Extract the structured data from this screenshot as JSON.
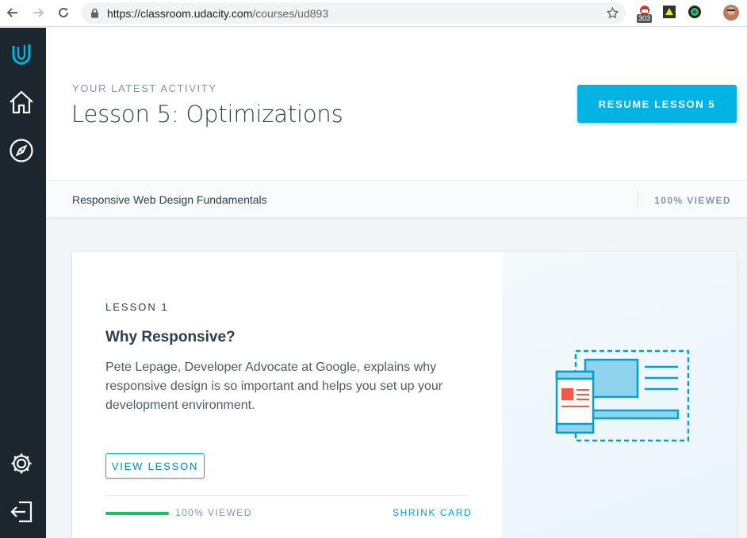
{
  "browser": {
    "url_host": "https://classroom.udacity.com",
    "url_path": "/courses/ud893",
    "extension_badge": "303",
    "icons": [
      "back-arrow-icon",
      "forward-arrow-icon",
      "reload-icon",
      "lock-icon",
      "star-icon"
    ]
  },
  "sidebar": {
    "items": [
      {
        "name": "udacity-logo-icon"
      },
      {
        "name": "home-icon"
      },
      {
        "name": "compass-icon"
      },
      {
        "name": "gear-icon"
      },
      {
        "name": "sign-out-icon"
      }
    ]
  },
  "header": {
    "eyebrow": "YOUR LATEST ACTIVITY",
    "title": "Lesson 5: Optimizations",
    "resume_label": "RESUME LESSON 5"
  },
  "subbar": {
    "course_name": "Responsive Web Design Fundamentals",
    "viewed": "100% VIEWED"
  },
  "card": {
    "lesson_number": "LESSON 1",
    "title": "Why Responsive?",
    "description": "Pete Lepage, Developer Advocate at Google, explains why responsive design is so important and helps you set up your development environment.",
    "view_label": "VIEW LESSON",
    "progress": 1.0,
    "viewed": "100% VIEWED",
    "shrink_label": "SHRINK CARD"
  },
  "colors": {
    "sidebar": "#1c262f",
    "accent": "#02b3e4",
    "progress": "#15c26b",
    "illustration_red": "#f15a4a"
  }
}
